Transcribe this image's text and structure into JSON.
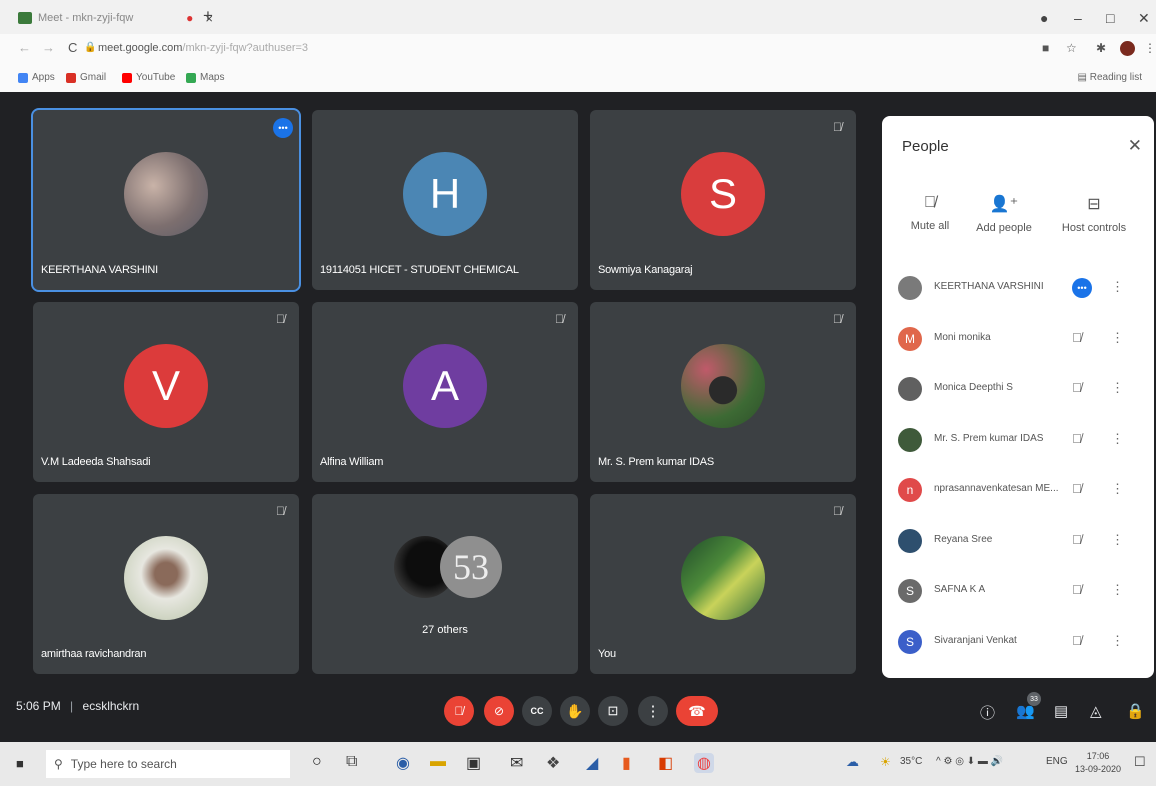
{
  "browser": {
    "tab_title": "Meet - mkn-zyji-fqw",
    "tab_close": "×",
    "new_tab": "+",
    "url_host": "meet.google.com",
    "url_path": "/mkn-zyji-fqw?authuser=3",
    "bookmarks": [
      {
        "label": "Apps",
        "color": "#4285f4"
      },
      {
        "label": "Gmail",
        "color": "#d93025"
      },
      {
        "label": "YouTube",
        "color": "#ff0000"
      },
      {
        "label": "Maps",
        "color": "#34a853"
      }
    ],
    "reading_list": "Reading list"
  },
  "tiles": [
    {
      "name": "KEERTHANA VARSHINI",
      "type": "photo",
      "active": true,
      "colors": [
        "#9b8a88",
        "#6a6a7a"
      ]
    },
    {
      "name": "19114051 HICET - STUDENT CHEMICAL",
      "type": "letter",
      "letter": "H",
      "color": "#4b86b4"
    },
    {
      "name": "Sowmiya Kanagaraj",
      "type": "letter",
      "letter": "S",
      "color": "#d93d3d",
      "muted": true
    },
    {
      "name": "V.M Ladeeda Shahsadi",
      "type": "letter",
      "letter": "V",
      "color": "#dc3b3b",
      "muted": true
    },
    {
      "name": "Alfina William",
      "type": "letter",
      "letter": "A",
      "color": "#6f3da0",
      "muted": true
    },
    {
      "name": "Mr. S. Prem kumar IDAS",
      "type": "photo",
      "colors": [
        "#3d6a34",
        "#b84a5b"
      ],
      "muted": true
    },
    {
      "name": "amirthaa ravichandran",
      "type": "photo",
      "colors": [
        "#cfd4c8",
        "#8a6a5a"
      ],
      "muted": true
    },
    {
      "name": "",
      "others": "27 others",
      "count": "53",
      "type": "others"
    },
    {
      "name": "You",
      "type": "photo",
      "colors": [
        "#2f6a3a",
        "#c9d35a"
      ],
      "muted": true
    }
  ],
  "people": {
    "title": "People",
    "close": "✕",
    "actions": [
      {
        "label": "Mute all",
        "icon": "mic-off-icon",
        "glyph": "🎙"
      },
      {
        "label": "Add people",
        "icon": "add-person-icon",
        "glyph": "👤⁺"
      },
      {
        "label": "Host controls",
        "icon": "host-controls-icon",
        "glyph": "⊟"
      }
    ],
    "list": [
      {
        "name": "KEERTHANA VARSHINI",
        "initial": "",
        "color": "#7a7a7a",
        "speaking": true
      },
      {
        "name": "Moni monika",
        "initial": "M",
        "color": "#e0674b"
      },
      {
        "name": "Monica Deepthi S",
        "initial": "",
        "color": "#606060"
      },
      {
        "name": "Mr. S. Prem kumar IDAS",
        "initial": "",
        "color": "#3f5a3a"
      },
      {
        "name": "nprasannavenkatesan ME...",
        "initial": "n",
        "color": "#e04a4a"
      },
      {
        "name": "Reyana Sree",
        "initial": "",
        "color": "#2e4f6e"
      },
      {
        "name": "SAFNA K A",
        "initial": "S",
        "color": "#6a6a6a"
      },
      {
        "name": "Sivaranjani Venkat",
        "initial": "S",
        "color": "#3b5fc9"
      }
    ]
  },
  "controls": {
    "time": "5:06 PM",
    "separator": "|",
    "meeting_code": "ecsklhckrn",
    "participants_count": "33"
  },
  "taskbar": {
    "search_placeholder": "Type here to search",
    "weather": "35°C",
    "lang": "ENG",
    "time": "17:06",
    "date": "13-09-2020"
  }
}
